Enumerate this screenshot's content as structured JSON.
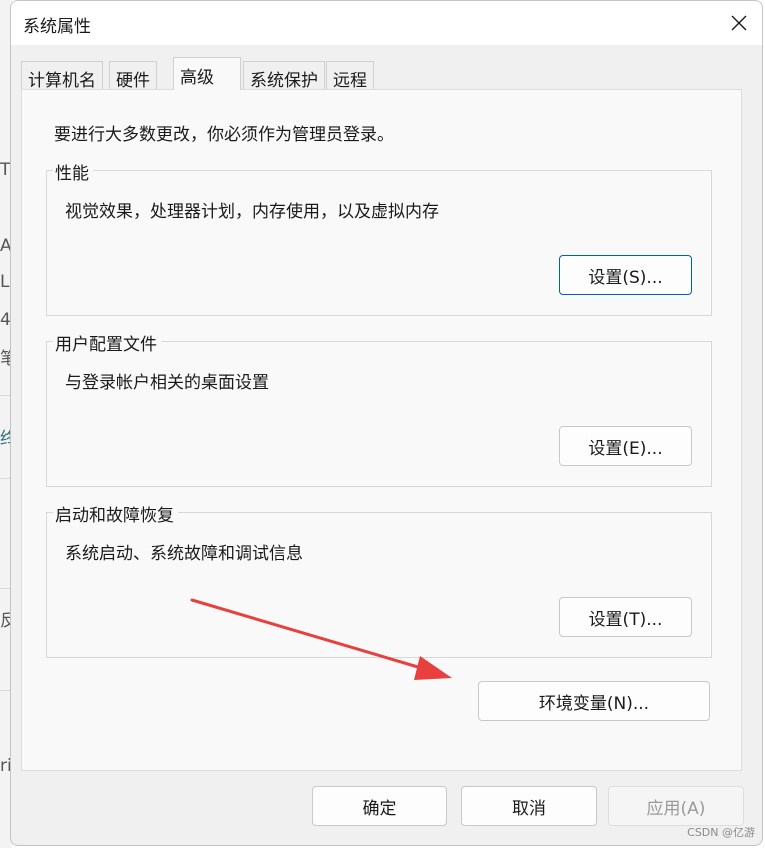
{
  "background": {
    "chars": [
      "T",
      "A",
      "L",
      "4",
      "笔",
      "终",
      "反",
      "ri"
    ]
  },
  "dialog": {
    "title": "系统属性"
  },
  "tabs": [
    {
      "label": "计算机名"
    },
    {
      "label": "硬件"
    },
    {
      "label": "高级",
      "active": true
    },
    {
      "label": "系统保护"
    },
    {
      "label": "远程"
    }
  ],
  "advanced": {
    "admin_note": "要进行大多数更改，你必须作为管理员登录。",
    "performance": {
      "title": "性能",
      "description": "视觉效果，处理器计划，内存使用，以及虚拟内存",
      "button": "设置(S)..."
    },
    "user_profiles": {
      "title": "用户配置文件",
      "description": "与登录帐户相关的桌面设置",
      "button": "设置(E)..."
    },
    "startup_recovery": {
      "title": "启动和故障恢复",
      "description": "系统启动、系统故障和调试信息",
      "button": "设置(T)..."
    },
    "env_button": "环境变量(N)..."
  },
  "footer": {
    "ok": "确定",
    "cancel": "取消",
    "apply": "应用(A)"
  },
  "annotation": {
    "arrow_color": "#e8403e"
  },
  "watermark": "CSDN @亿游",
  "colors": {
    "accent_focus": "#005fb8",
    "window_bg": "#f0f0f0",
    "panel_bg": "#f9f9f9"
  },
  "icons": {
    "close": "close-icon"
  }
}
